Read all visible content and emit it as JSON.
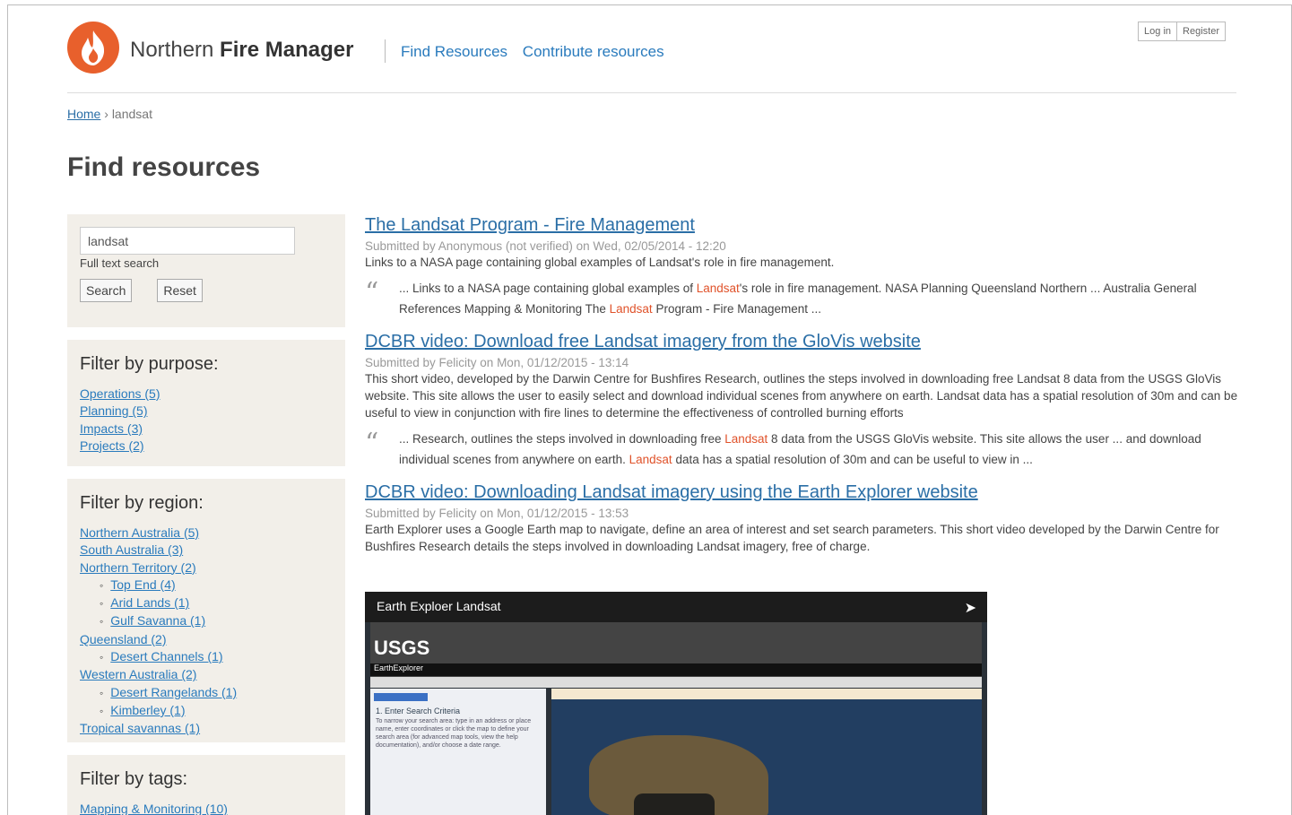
{
  "header": {
    "site_name_light": "Northern",
    "site_name_bold": "Fire Manager",
    "nav": [
      "Find Resources",
      "Contribute resources"
    ],
    "login_label": "Log in",
    "register_label": "Register",
    "brand_color": "#e8602c"
  },
  "breadcrumb": {
    "home": "Home",
    "current": "landsat"
  },
  "page_title": "Find resources",
  "search": {
    "value": "landsat",
    "hint": "Full text search",
    "search_label": "Search",
    "reset_label": "Reset"
  },
  "filters": {
    "purpose": {
      "title": "Filter by purpose:",
      "items": [
        "Operations (5)",
        "Planning (5)",
        "Impacts (3)",
        "Projects (2)"
      ]
    },
    "region": {
      "title": "Filter by region:",
      "items": [
        "Northern Australia (5)",
        "South Australia (3)",
        "Northern Territory (2)",
        "Top End (4)",
        "Arid Lands (1)",
        "Gulf Savanna (1)",
        "Queensland (2)",
        "Desert Channels (1)",
        "Western Australia (2)",
        "Desert Rangelands (1)",
        "Kimberley (1)",
        "Tropical savannas (1)"
      ]
    },
    "tags": {
      "title": "Filter by tags:",
      "items": [
        "Mapping & Monitoring (10)"
      ]
    }
  },
  "results": [
    {
      "title": "The Landsat Program - Fire Management",
      "meta": "Submitted by Anonymous (not verified) on Wed, 02/05/2014 - 12:20",
      "desc": "Links to a NASA page containing global examples of Landsat's role in fire management.",
      "snippet": {
        "p1": "... Links to a NASA page containing global examples of ",
        "hl1": "Landsat",
        "p2": "'s role in fire management. NASA Planning Queensland Northern ... Australia General References Mapping & Monitoring The ",
        "hl2": "Landsat",
        "p3": " Program - Fire Management ..."
      }
    },
    {
      "title": "DCBR video: Download free Landsat imagery from the GloVis website",
      "meta": "Submitted by Felicity on Mon, 01/12/2015 - 13:14",
      "desc": "This short video, developed by the Darwin Centre for Bushfires Research, outlines the steps involved in downloading free Landsat 8 data from the USGS GloVis website. This site allows the user to easily select and download individual scenes from anywhere on earth. Landsat data has a spatial resolution of 30m and can be useful to view in conjunction with fire lines to determine the effectiveness of controlled burning efforts",
      "snippet": {
        "p1": "... Research, outlines the steps involved in downloading free ",
        "hl1": "Landsat",
        "p2": " 8 data from the USGS GloVis website. This site allows the user ... and download individual scenes from anywhere on earth. ",
        "hl2": "Landsat",
        "p3": " data has a spatial resolution of 30m and can be useful to view in ..."
      }
    },
    {
      "title": "DCBR video: Downloading Landsat imagery using the Earth Explorer website",
      "meta": "Submitted by Felicity on Mon, 01/12/2015 - 13:53",
      "desc": "Earth Explorer uses a Google Earth map to navigate, define an area of interest and set search parameters. This short video developed by the Darwin Centre for Bushfires Research details the steps involved in downloading Landsat imagery, free of charge."
    }
  ],
  "video": {
    "title": "Earth Exploer Landsat",
    "usgs": "USGS",
    "app": "EarthExplorer",
    "step": "1. Enter Search Criteria",
    "step_text": "To narrow your search area: type in an address or place name, enter coordinates or click the map to define your search area (for advanced map tools, view the help documentation), and/or choose a date range."
  }
}
